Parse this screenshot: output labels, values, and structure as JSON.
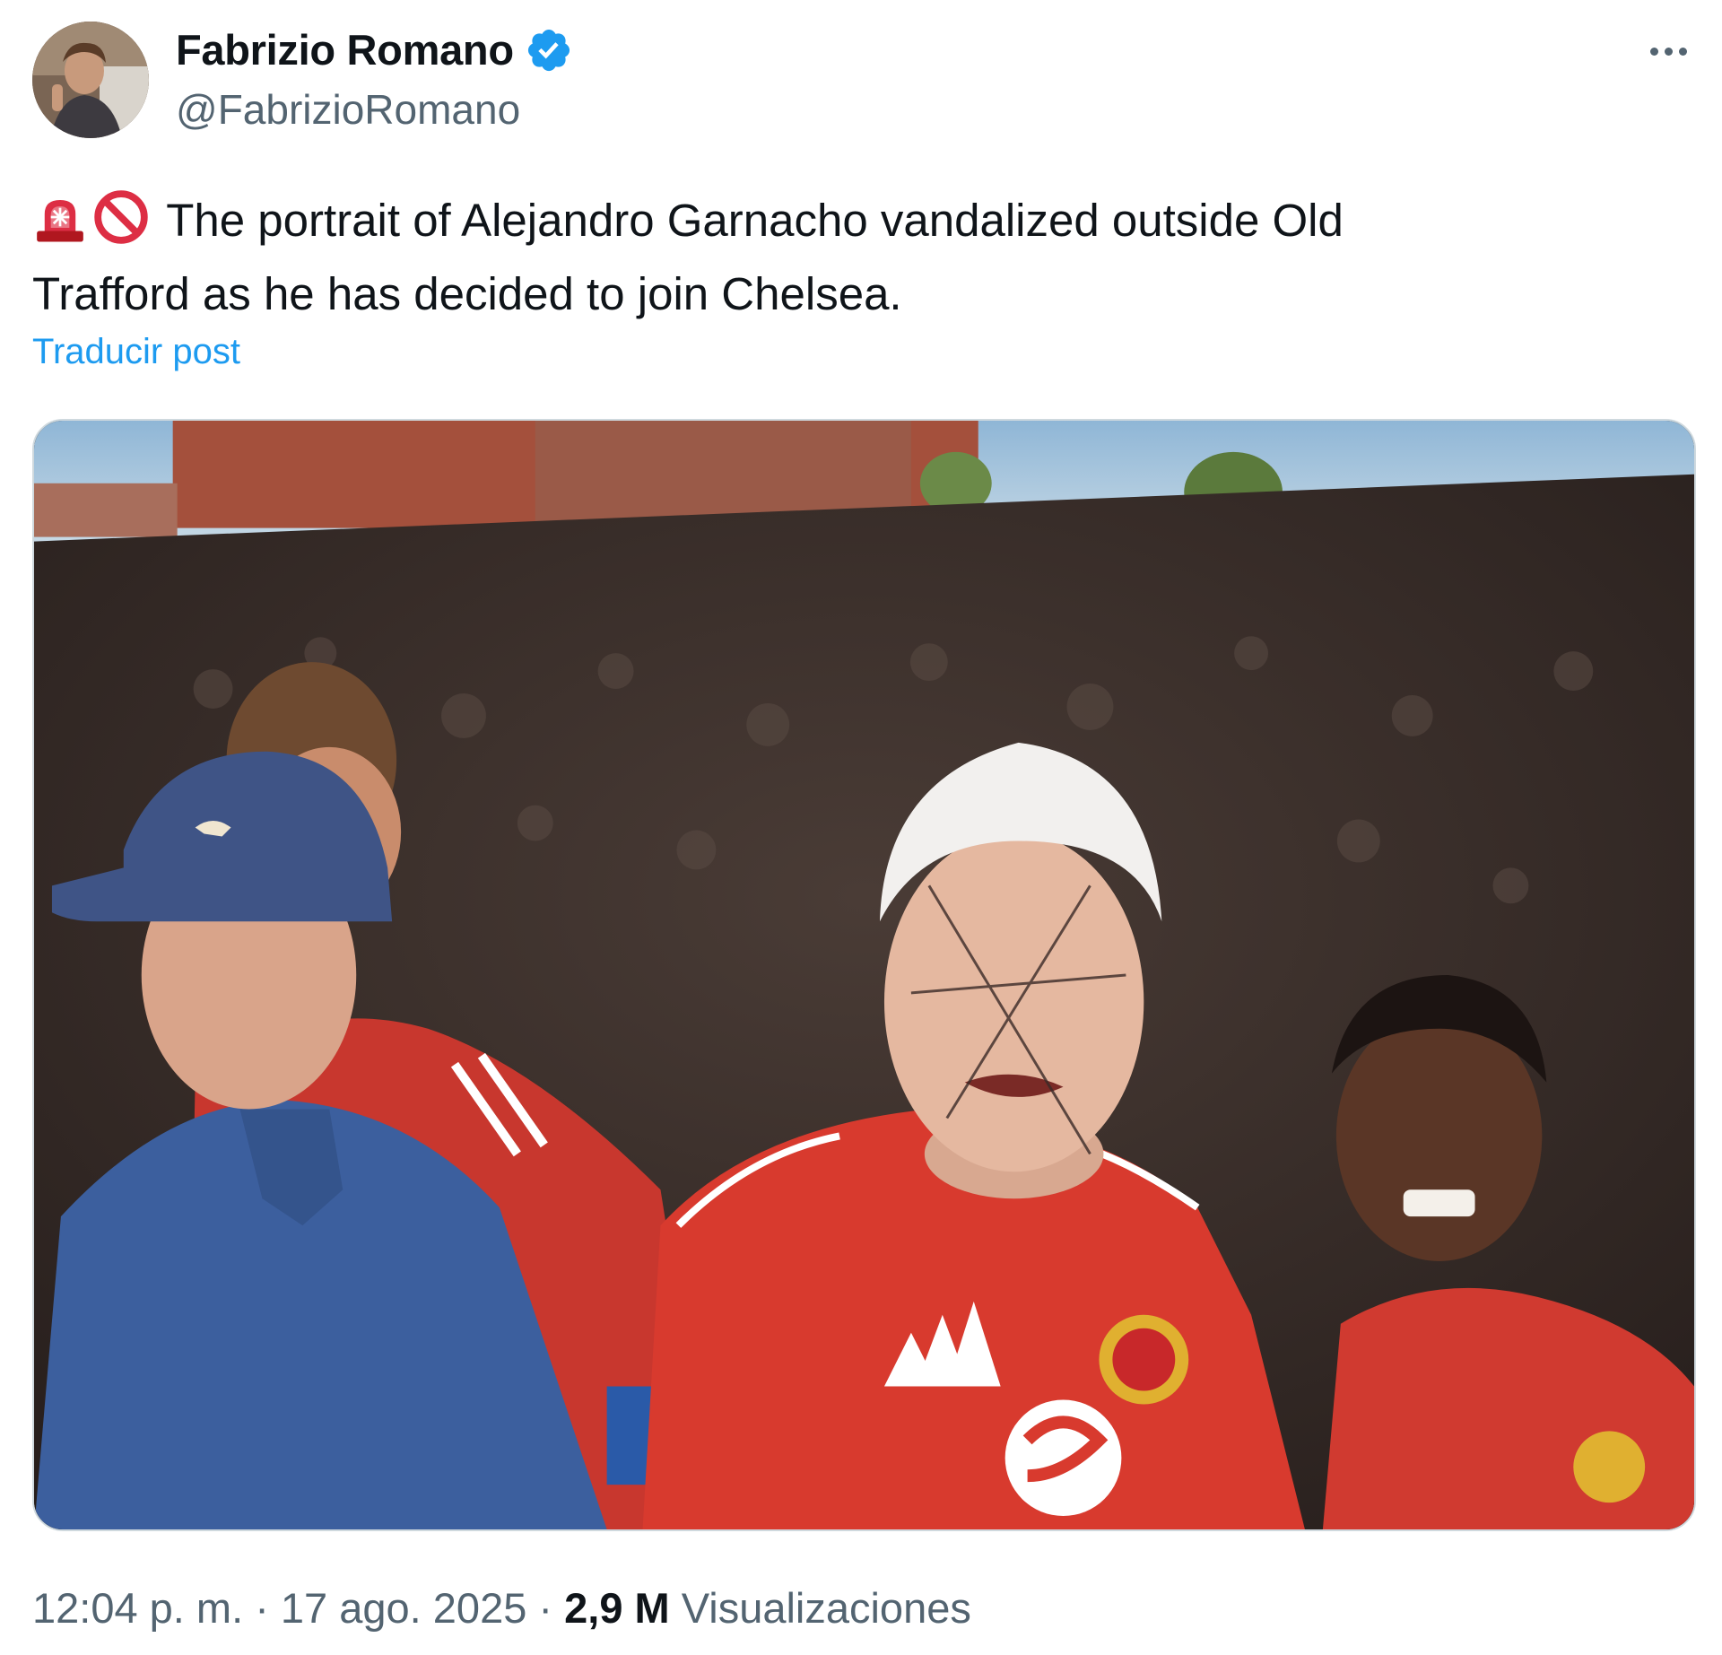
{
  "author": {
    "display_name": "Fabrizio Romano",
    "handle": "@FabrizioRomano",
    "verified": true,
    "avatar_icon": "profile-photo"
  },
  "tweet": {
    "emojis": [
      "rotating-light-icon",
      "no-entry-sign-icon"
    ],
    "text_line_1": "The portrait of Alejandro Garnacho vandalized outside Old",
    "text_line_2": "Trafford as he has decided to join Chelsea.",
    "translate_label": "Traducir post"
  },
  "media": {
    "description_icon": "photo-mural-vandalized"
  },
  "meta": {
    "time": "12:04 p. m.",
    "separator": "·",
    "date": "17 ago. 2025",
    "views_count": "2,9 M",
    "views_label": "Visualizaciones"
  },
  "colors": {
    "accent": "#1d9bf0",
    "secondary_text": "#536471",
    "primary_text": "#0f1419",
    "border": "#cfd9de"
  }
}
